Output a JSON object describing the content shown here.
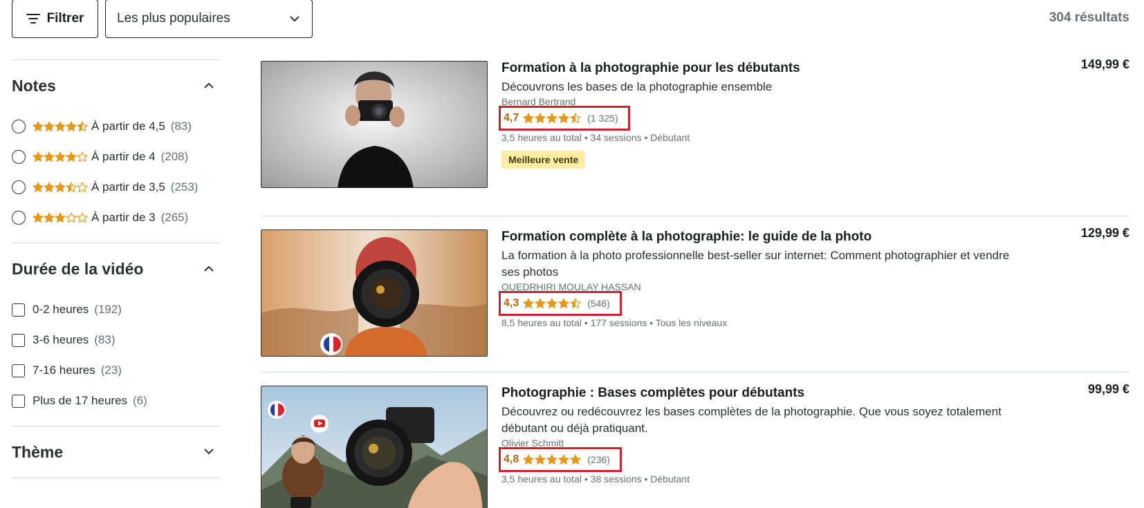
{
  "toolbar": {
    "filter_label": "Filtrer",
    "sort_value": "Les plus populaires",
    "results_count": "304 résultats"
  },
  "sidebar": {
    "ratings": {
      "title": "Notes",
      "options": [
        {
          "label": "À partir de 4,5",
          "count": "(83)",
          "stars": 4.5
        },
        {
          "label": "À partir de 4",
          "count": "(208)",
          "stars": 4
        },
        {
          "label": "À partir de 3,5",
          "count": "(253)",
          "stars": 3.5
        },
        {
          "label": "À partir de 3",
          "count": "(265)",
          "stars": 3
        }
      ]
    },
    "duration": {
      "title": "Durée de la vidéo",
      "options": [
        {
          "label": "0-2 heures",
          "count": "(192)"
        },
        {
          "label": "3-6 heures",
          "count": "(83)"
        },
        {
          "label": "7-16 heures",
          "count": "(23)"
        },
        {
          "label": "Plus de 17 heures",
          "count": "(6)"
        }
      ]
    },
    "theme": {
      "title": "Thème"
    }
  },
  "courses": [
    {
      "title": "Formation à la photographie pour les débutants",
      "description": "Découvrons les bases de la photographie ensemble",
      "author": "Bernard Bertrand",
      "rating": "4,7",
      "stars": 4.5,
      "rating_count": "(1 325)",
      "meta": "3,5 heures au total • 34 sessions • Débutant",
      "badge": "Meilleure vente",
      "price": "149,99 €"
    },
    {
      "title": "Formation complète à la photographie: le guide de la photo",
      "description": "La formation à la photo professionnelle best-seller sur internet: Comment photographier et vendre ses photos",
      "author": "OUEDRHIRI MOULAY HASSAN",
      "rating": "4,3",
      "stars": 4.5,
      "rating_count": "(546)",
      "meta": "8,5 heures au total • 177 sessions • Tous les niveaux",
      "price": "129,99 €"
    },
    {
      "title": "Photographie : Bases complètes pour débutants",
      "description": "Découvrez ou redécouvrez les bases complètes de la photographie. Que vous soyez totalement débutant ou déjà pratiquant.",
      "author": "Olivier Schmitt",
      "rating": "4,8",
      "stars": 5,
      "rating_count": "(236)",
      "meta": "3,5 heures au total • 38 sessions • Débutant",
      "price": "99,99 €"
    }
  ],
  "colors": {
    "star": "#e59819",
    "rating": "#b4690e",
    "highlight_box": "#d0212e",
    "badge_bg": "#fceca4"
  }
}
